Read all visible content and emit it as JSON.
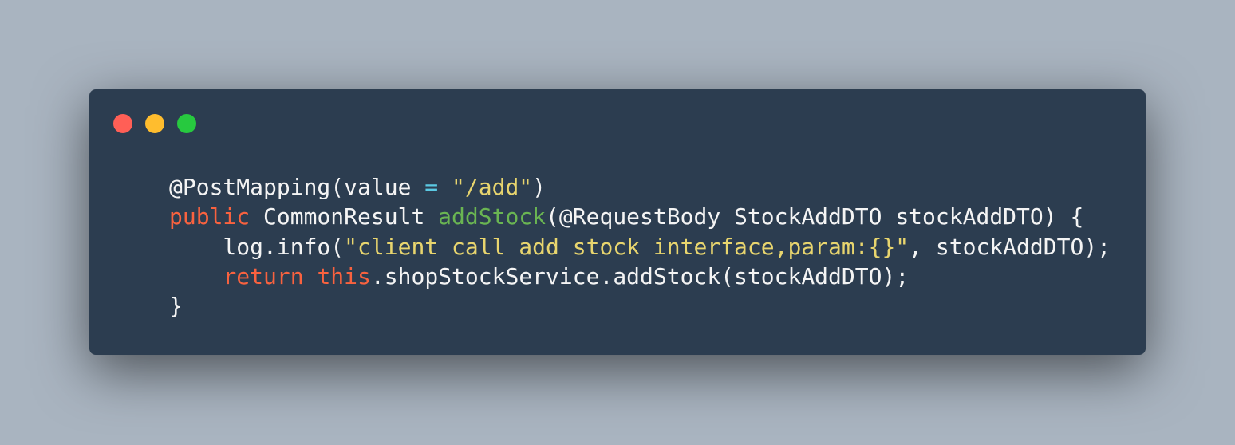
{
  "window": {
    "controls": [
      "close",
      "minimize",
      "maximize"
    ]
  },
  "colors": {
    "background": "#a9b4c0",
    "window": "#2c3d50",
    "keyword": "#f9623f",
    "string": "#e8d56e",
    "function": "#6ab552",
    "operator": "#5bc9e3",
    "text": "#f4f4f4"
  },
  "code": {
    "l1": {
      "a": "@PostMapping(value ",
      "op": "=",
      "b": " ",
      "s": "\"/add\"",
      "c": ")"
    },
    "l2": {
      "indent": "",
      "kw": "public",
      "a": " CommonResult ",
      "fn": "addStock",
      "b": "(@RequestBody StockAddDTO stockAddDTO) {"
    },
    "l3": {
      "a": "    log.info(",
      "s": "\"client call add stock interface,param:{}\"",
      "b": ", stockAddDTO);"
    },
    "l4": {
      "pre": "    ",
      "kw1": "return",
      "sp": " ",
      "kw2": "this",
      "b": ".shopStockService.addStock(stockAddDTO);"
    },
    "l5": {
      "a": "}"
    }
  }
}
